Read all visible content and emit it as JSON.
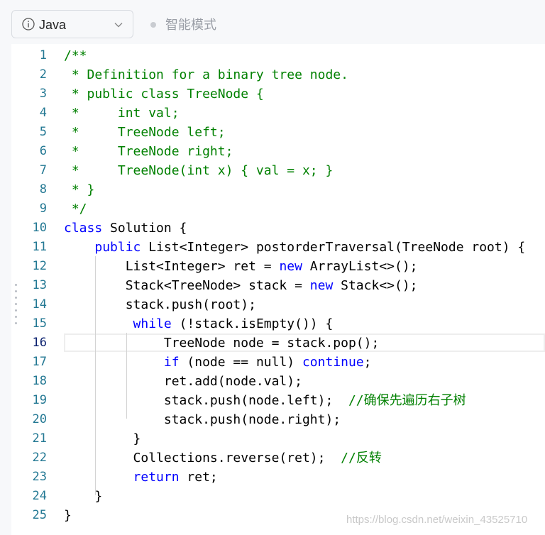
{
  "toolbar": {
    "language": "Java",
    "mode": "智能模式"
  },
  "editor": {
    "active_line": 16,
    "lines": [
      {
        "n": "1",
        "code": "<span class=\"cm\">/**</span>"
      },
      {
        "n": "2",
        "code": "<span class=\"cm\"> * Definition for a binary tree node.</span>"
      },
      {
        "n": "3",
        "code": "<span class=\"cm\"> * public class TreeNode {</span>"
      },
      {
        "n": "4",
        "code": "<span class=\"cm\"> *     int val;</span>"
      },
      {
        "n": "5",
        "code": "<span class=\"cm\"> *     TreeNode left;</span>"
      },
      {
        "n": "6",
        "code": "<span class=\"cm\"> *     TreeNode right;</span>"
      },
      {
        "n": "7",
        "code": "<span class=\"cm\"> *     TreeNode(int x) { val = x; }</span>"
      },
      {
        "n": "8",
        "code": "<span class=\"cm\"> * }</span>"
      },
      {
        "n": "9",
        "code": "<span class=\"cm\"> */</span>"
      },
      {
        "n": "10",
        "code": "<span class=\"kw\">class</span> Solution {"
      },
      {
        "n": "11",
        "code": "    <span class=\"kw\">public</span> List&lt;Integer&gt; postorderTraversal(TreeNode root) {"
      },
      {
        "n": "12",
        "code": "        List&lt;Integer&gt; ret = <span class=\"kw\">new</span> ArrayList&lt;&gt;();"
      },
      {
        "n": "13",
        "code": "        Stack&lt;TreeNode&gt; stack = <span class=\"kw\">new</span> Stack&lt;&gt;();"
      },
      {
        "n": "14",
        "code": "        stack.push(root);"
      },
      {
        "n": "15",
        "code": "         <span class=\"kw\">while</span> (!stack.isEmpty()) {"
      },
      {
        "n": "16",
        "code": "             TreeNode node = stack.pop();"
      },
      {
        "n": "17",
        "code": "             <span class=\"kw\">if</span> (node == null) <span class=\"kw\">continue</span>;"
      },
      {
        "n": "18",
        "code": "             ret.add(node.val);"
      },
      {
        "n": "19",
        "code": "             stack.push(node.left);  <span class=\"cm\">//确保先遍历右子树</span>"
      },
      {
        "n": "20",
        "code": "             stack.push(node.right);"
      },
      {
        "n": "21",
        "code": "         }"
      },
      {
        "n": "22",
        "code": "         Collections.reverse(ret);  <span class=\"cm\">//反转</span>"
      },
      {
        "n": "23",
        "code": "         <span class=\"kw\">return</span> ret;"
      },
      {
        "n": "24",
        "code": "    }"
      },
      {
        "n": "25",
        "code": "}"
      }
    ]
  },
  "watermark": "https://blog.csdn.net/weixin_43525710"
}
